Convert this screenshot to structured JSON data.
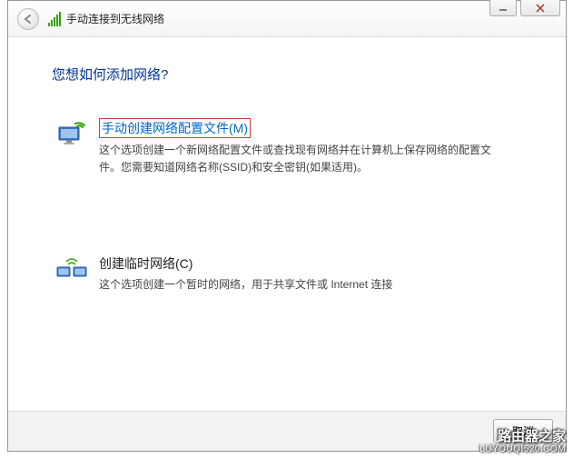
{
  "header": {
    "title": "手动连接到无线网络"
  },
  "question": "您想如何添加网络?",
  "options": {
    "manual": {
      "title": "手动创建网络配置文件(M)",
      "desc": "这个选项创建一个新网络配置文件或查找现有网络并在计算机上保存网络的配置文件。您需要知道网络名称(SSID)和安全密钥(如果适用)。"
    },
    "adhoc": {
      "title": "创建临时网络(C)",
      "desc": "这个选项创建一个暂时的网络，用于共享文件或 Internet 连接"
    }
  },
  "buttons": {
    "cancel": "取消"
  },
  "watermark": {
    "brand": "路由器之家",
    "url": "LUYOUQI520.COM"
  }
}
